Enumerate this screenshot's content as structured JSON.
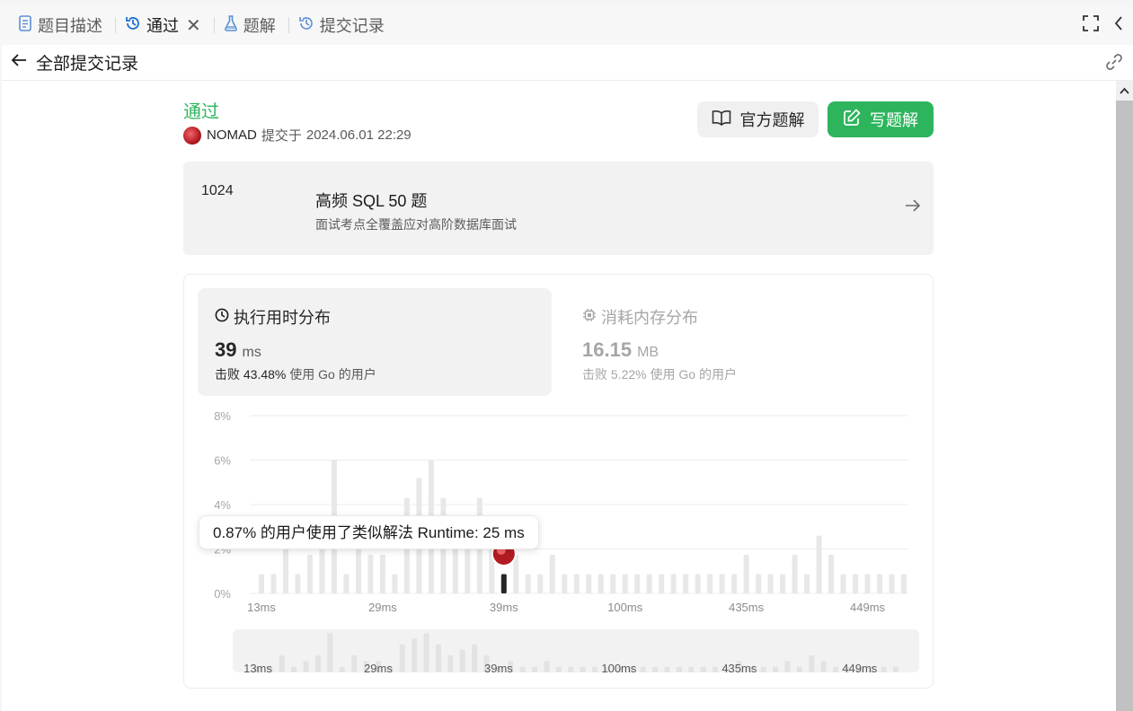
{
  "tabs": [
    {
      "label": "题目描述",
      "icon": "document-icon",
      "active": false
    },
    {
      "label": "通过",
      "icon": "history-icon",
      "active": true
    },
    {
      "label": "题解",
      "icon": "flask-icon",
      "active": false
    },
    {
      "label": "提交记录",
      "icon": "history-icon",
      "active": false
    }
  ],
  "subheader": {
    "title": "全部提交记录"
  },
  "submission": {
    "status": "通过",
    "status_color": "#2db55d",
    "user": "NOMAD",
    "submitted_label": "提交于",
    "time": "2024.06.01 22:29",
    "official_button": "官方题解",
    "write_button": "写题解"
  },
  "study_plan": {
    "problem_number": "1024",
    "name": "高频 SQL 50 题",
    "description": "面试考点全覆盖应对高阶数据库面试"
  },
  "runtime": {
    "title": "执行用时分布",
    "value": "39",
    "unit": "ms",
    "beat_label": "击败",
    "beat_pct": "43.48%",
    "beat_suffix": "使用 Go 的用户"
  },
  "memory": {
    "title": "消耗内存分布",
    "value": "16.15",
    "unit": "MB",
    "beat_label": "击败",
    "beat_pct": "5.22%",
    "beat_suffix": "使用 Go 的用户"
  },
  "tooltip": "0.87% 的用户使用了类似解法 Runtime: 25 ms",
  "chart_data": {
    "type": "bar",
    "y_ticks": [
      "8%",
      "6%",
      "4%",
      "2%",
      "0%"
    ],
    "ylim": [
      0,
      8
    ],
    "x_tick_labels": [
      "13ms",
      "29ms",
      "39ms",
      "100ms",
      "435ms",
      "449ms"
    ],
    "values": [
      0.87,
      0.87,
      2.6,
      0.87,
      1.74,
      2.6,
      6.0,
      0.87,
      2.6,
      1.74,
      1.74,
      0.87,
      4.3,
      5.2,
      6.0,
      4.3,
      2.6,
      3.5,
      4.3,
      2.6,
      0.87,
      1.74,
      0.87,
      0.87,
      1.74,
      0.87,
      0.87,
      0.87,
      0.87,
      0.87,
      0.87,
      0.87,
      0.87,
      0.87,
      0.87,
      0.87,
      0.87,
      0.87,
      0.87,
      0.87,
      1.74,
      0.87,
      0.87,
      0.87,
      1.74,
      0.87,
      2.6,
      1.74,
      0.87,
      0.87,
      0.87,
      0.87,
      0.87,
      0.87
    ],
    "highlight_index": 20,
    "highlight_label": "39ms"
  },
  "colors": {
    "accent": "#2db55d",
    "bar": "#e8e8e8",
    "highlight_bar": "#262626"
  }
}
